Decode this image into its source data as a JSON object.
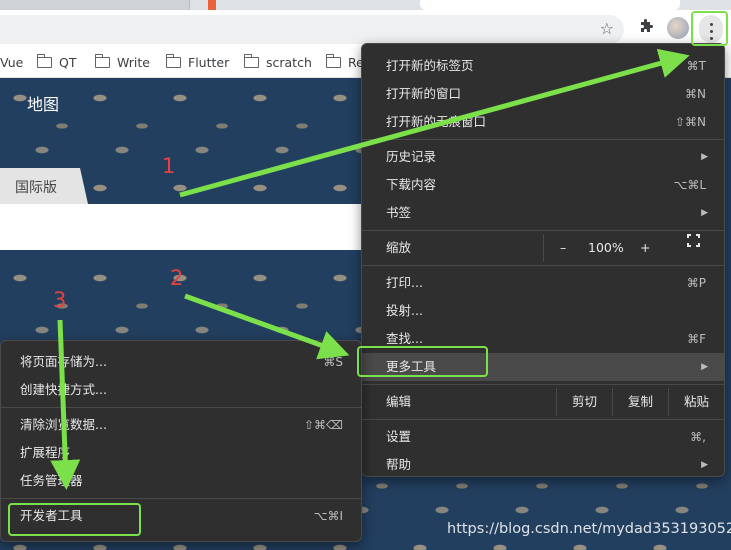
{
  "bookmarks": {
    "items": [
      "Vue",
      "QT",
      "Write",
      "Flutter",
      "scratch",
      "Re"
    ]
  },
  "page": {
    "map_title": "地图",
    "version_tab": "国际版"
  },
  "main_menu": {
    "new_tab": {
      "label": "打开新的标签页",
      "shortcut": "⌘T"
    },
    "new_window": {
      "label": "打开新的窗口",
      "shortcut": "⌘N"
    },
    "incognito": {
      "label": "打开新的无痕窗口",
      "shortcut": "⇧⌘N"
    },
    "history": {
      "label": "历史记录"
    },
    "downloads": {
      "label": "下载内容",
      "shortcut": "⌥⌘L"
    },
    "bookmarks": {
      "label": "书签"
    },
    "zoom": {
      "label": "缩放",
      "minus": "–",
      "value": "100%",
      "plus": "+"
    },
    "print": {
      "label": "打印...",
      "shortcut": "⌘P"
    },
    "cast": {
      "label": "投射..."
    },
    "find": {
      "label": "查找...",
      "shortcut": "⌘F"
    },
    "more_tools": {
      "label": "更多工具"
    },
    "edit": {
      "label": "编辑",
      "cut": "剪切",
      "copy": "复制",
      "paste": "粘贴"
    },
    "settings": {
      "label": "设置",
      "shortcut": "⌘,"
    },
    "help": {
      "label": "帮助"
    }
  },
  "sub_menu": {
    "save_page": {
      "label": "将页面存储为...",
      "shortcut": "⌘S"
    },
    "create_shortcut": {
      "label": "创建快捷方式..."
    },
    "clear_data": {
      "label": "清除浏览数据...",
      "shortcut": "⇧⌘⌫"
    },
    "extensions": {
      "label": "扩展程序"
    },
    "task_manager": {
      "label": "任务管理器"
    },
    "dev_tools": {
      "label": "开发者工具",
      "shortcut": "⌥⌘I"
    }
  },
  "annotations": {
    "step1": "1",
    "step2": "2",
    "step3": "3",
    "color": "#7ce04a"
  },
  "watermark": "https://blog.csdn.net/mydad353193052",
  "icons": [
    "star-icon",
    "puzzle-icon",
    "avatar",
    "kebab-menu-icon",
    "folder-icon",
    "fullscreen-icon",
    "chevron-right-icon"
  ]
}
